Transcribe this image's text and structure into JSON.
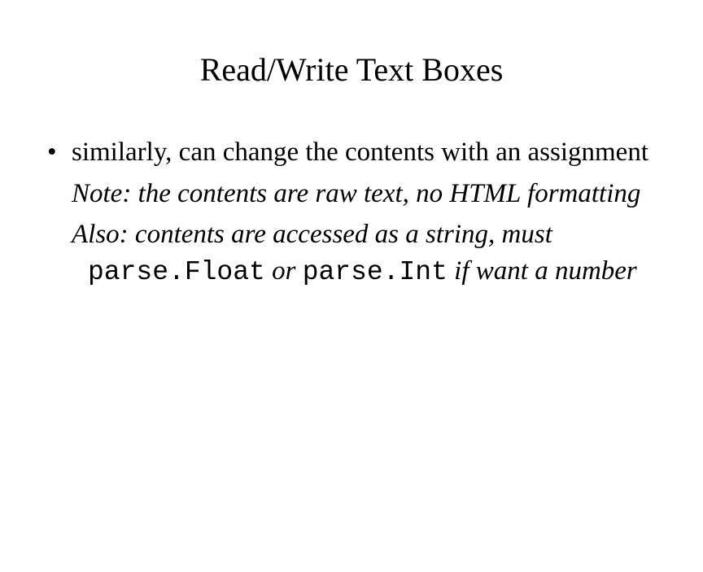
{
  "slide": {
    "title": "Read/Write Text Boxes",
    "bullet1": "similarly, can change the contents with an assignment",
    "note_label": "Note:",
    "note_text": " the contents are raw text, no HTML formatting",
    "also_label": "Also:",
    "also_pre": " contents are accessed as a string, must ",
    "code1": "parse.Float",
    "also_mid": " or ",
    "code2": "parse.Int",
    "also_post": " if want a number"
  }
}
